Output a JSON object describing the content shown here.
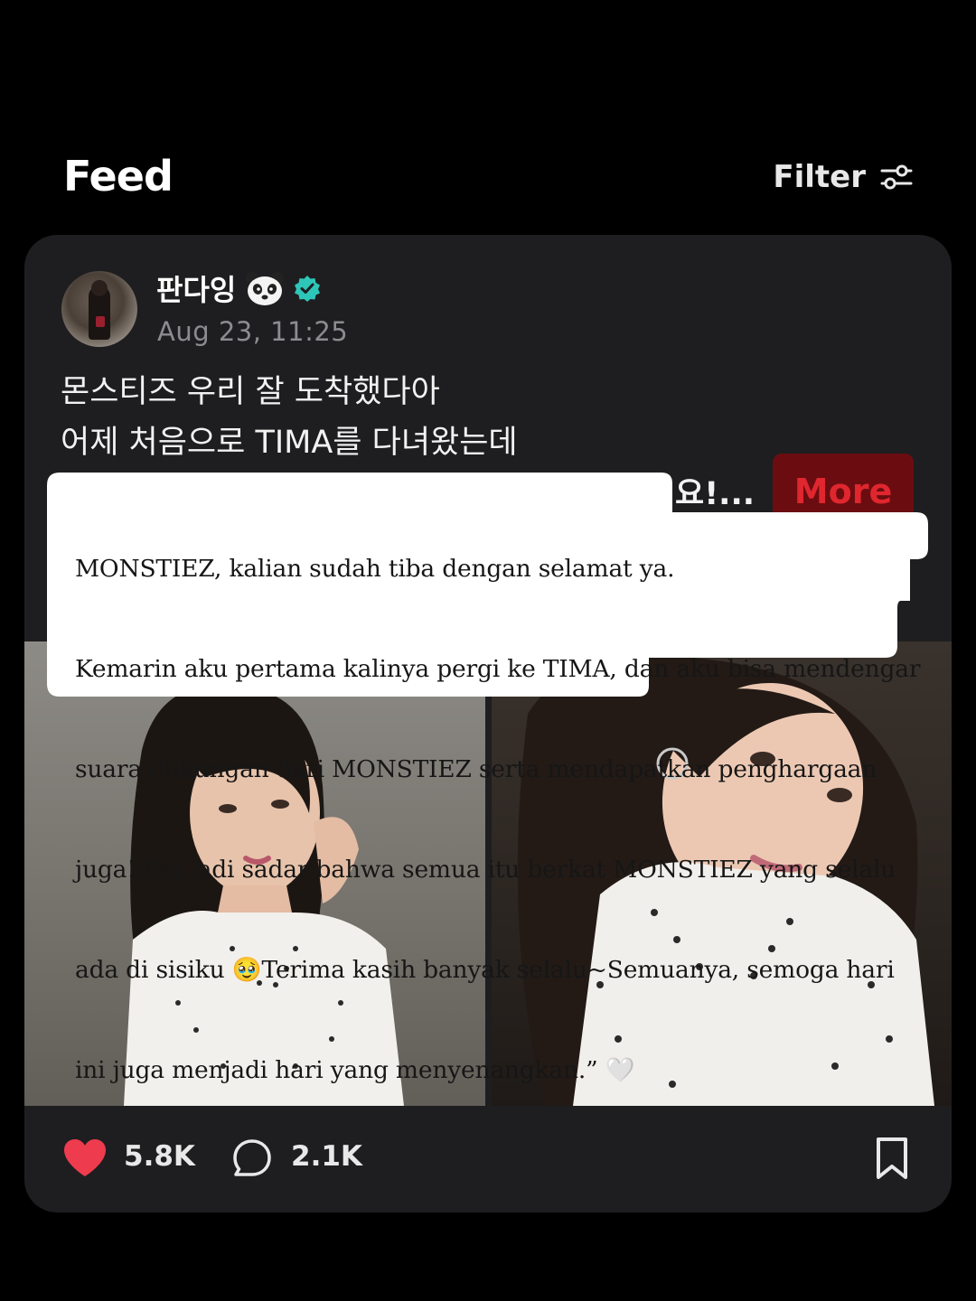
{
  "header": {
    "title": "Feed",
    "filter_label": "Filter"
  },
  "post": {
    "username": "판다잉",
    "timestamp": "Aug 23, 11:25",
    "text_lines": [
      "몬스티즈 우리 잘 도착했다아",
      "어제 처음으로 TIMA를 다녀왔는데"
    ],
    "text_tail": "요!...",
    "more_label": "More",
    "likes": "5.8K",
    "comments": "2.1K"
  },
  "caption": {
    "lines": [
      "MONSTIEZ, kalian sudah tiba dengan selamat ya.",
      "Kemarin aku pertama kalinya pergi ke TIMA, dan aku bisa mendengar",
      "suara dukungan dari MONSTIEZ serta mendapatkan penghargaan",
      "juga!Aku jadi sadar bahwa semua itu berkat MONSTIEZ yang selalu",
      "ada di sisiku 🥹Terima kasih banyak selalu~Semuanya, semoga hari",
      "ini juga menjadi hari yang menyenangkan.” 🤍"
    ]
  },
  "colors": {
    "background": "#000000",
    "card": "#1e1e20",
    "like": "#ef3b4e",
    "verified": "#2ec6b8",
    "more_bg": "#6b0d10",
    "more_text": "#e0262e"
  },
  "icons": [
    "filter-icon",
    "panda-icon",
    "verified-icon",
    "heart-icon",
    "comment-icon",
    "bookmark-icon"
  ]
}
